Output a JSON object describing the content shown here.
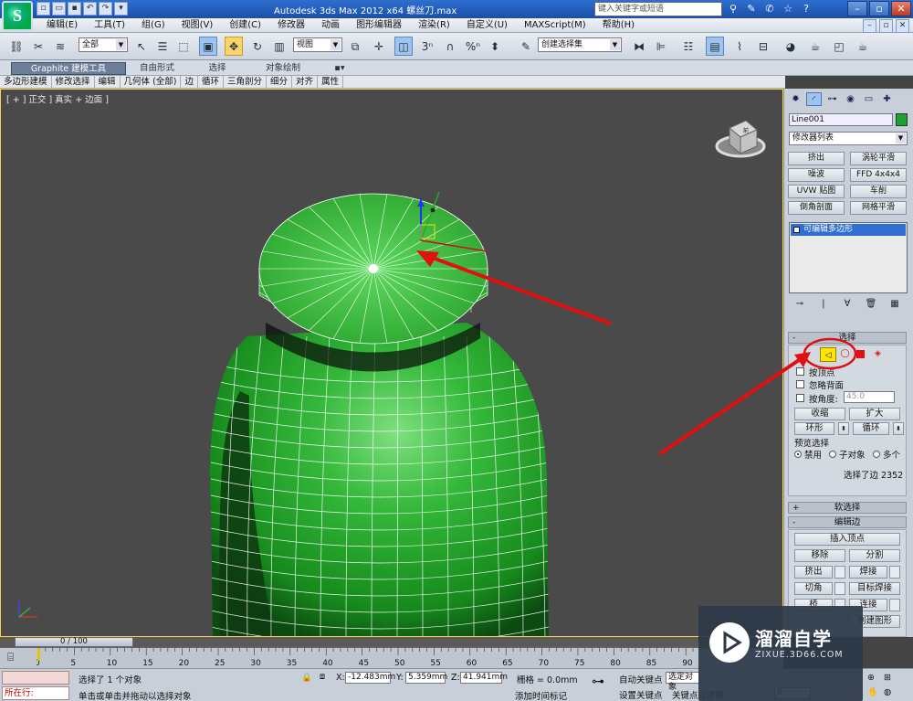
{
  "app": {
    "window_title": "Autodesk 3ds Max  2012 x64      螺丝刀.max",
    "logo_letter": "S",
    "search_placeholder": "键入关键字或短语"
  },
  "menu": [
    "编辑(E)",
    "工具(T)",
    "组(G)",
    "视图(V)",
    "创建(C)",
    "修改器",
    "动画",
    "图形编辑器",
    "渲染(R)",
    "自定义(U)",
    "MAXScript(M)",
    "帮助(H)"
  ],
  "toolbar": {
    "selection_filter": "全部",
    "ref_coord": "视图",
    "named_selection": "创建选择集"
  },
  "ribbon": {
    "tabs": [
      "Graphite 建模工具",
      "自由形式",
      "选择",
      "对象绘制"
    ],
    "subitems": [
      "多边形建模",
      "修改选择",
      "编辑",
      "几何体 (全部)",
      "边",
      "循环",
      "三角剖分",
      "细分",
      "对齐",
      "属性"
    ]
  },
  "viewport": {
    "label": "[ + ] 正交 ] 真实 + 边面 ]"
  },
  "command_panel": {
    "object_name": "Line001",
    "modifier_list": "修改器列表",
    "modifier_buttons": [
      "挤出",
      "涡轮平滑",
      "噪波",
      "FFD 4x4x4",
      "UVW 贴图",
      "车削",
      "倒角剖面",
      "网格平滑"
    ],
    "stack_item": "可编辑多边形",
    "selection_rollout": {
      "title": "选择",
      "by_vertex": "按顶点",
      "ignore_backface": "忽略背面",
      "by_angle": "按角度:",
      "angle_value": "45.0",
      "shrink": "收缩",
      "grow": "扩大",
      "ring": "环形",
      "loop": "循环",
      "preview_label": "预览选择",
      "preview_disabled": "禁用",
      "preview_subobject": "子对象",
      "preview_multi": "多个",
      "selected_info": "选择了边 2352"
    },
    "soft_selection": "软选择",
    "edit_edges": {
      "title": "编辑边",
      "insert_vertex": "插入顶点",
      "remove": "移除",
      "split": "分割",
      "extrude": "挤出",
      "weld": "焊接",
      "chamfer": "切角",
      "target_weld": "目标焊接",
      "bridge_partial": "桥",
      "connect": "连接",
      "create_shape": "创建图形"
    }
  },
  "timeline": {
    "slider_text": "0 / 100",
    "ticks": [
      "0",
      "5",
      "10",
      "15",
      "20",
      "25",
      "30",
      "35",
      "40",
      "45",
      "50",
      "55",
      "60",
      "65",
      "70",
      "75",
      "80",
      "85",
      "90"
    ]
  },
  "status": {
    "running": "所在行:",
    "line1": "选择了 1 个对象",
    "line2": "单击或单击并拖动以选择对象",
    "x_label": "X:",
    "x_value": "-12.483mm",
    "y_label": "Y:",
    "y_value": "5.359mm",
    "z_label": "Z:",
    "z_value": "41.941mm",
    "grid": "栅格 = 0.0mm",
    "auto_key": "自动关键点",
    "selected_dd": "选定对象",
    "set_key": "设置关键点",
    "key_filters": "关键点过滤器...",
    "add_time_tag": "添加时间标记",
    "frame_value": "0"
  },
  "watermark": {
    "title": "溜溜自学",
    "url": "ZIXUE.3D66.COM"
  },
  "colors": {
    "object_green": "#1aa532",
    "selection_blue": "#2f6fd0",
    "annotation_red": "#e01010"
  }
}
